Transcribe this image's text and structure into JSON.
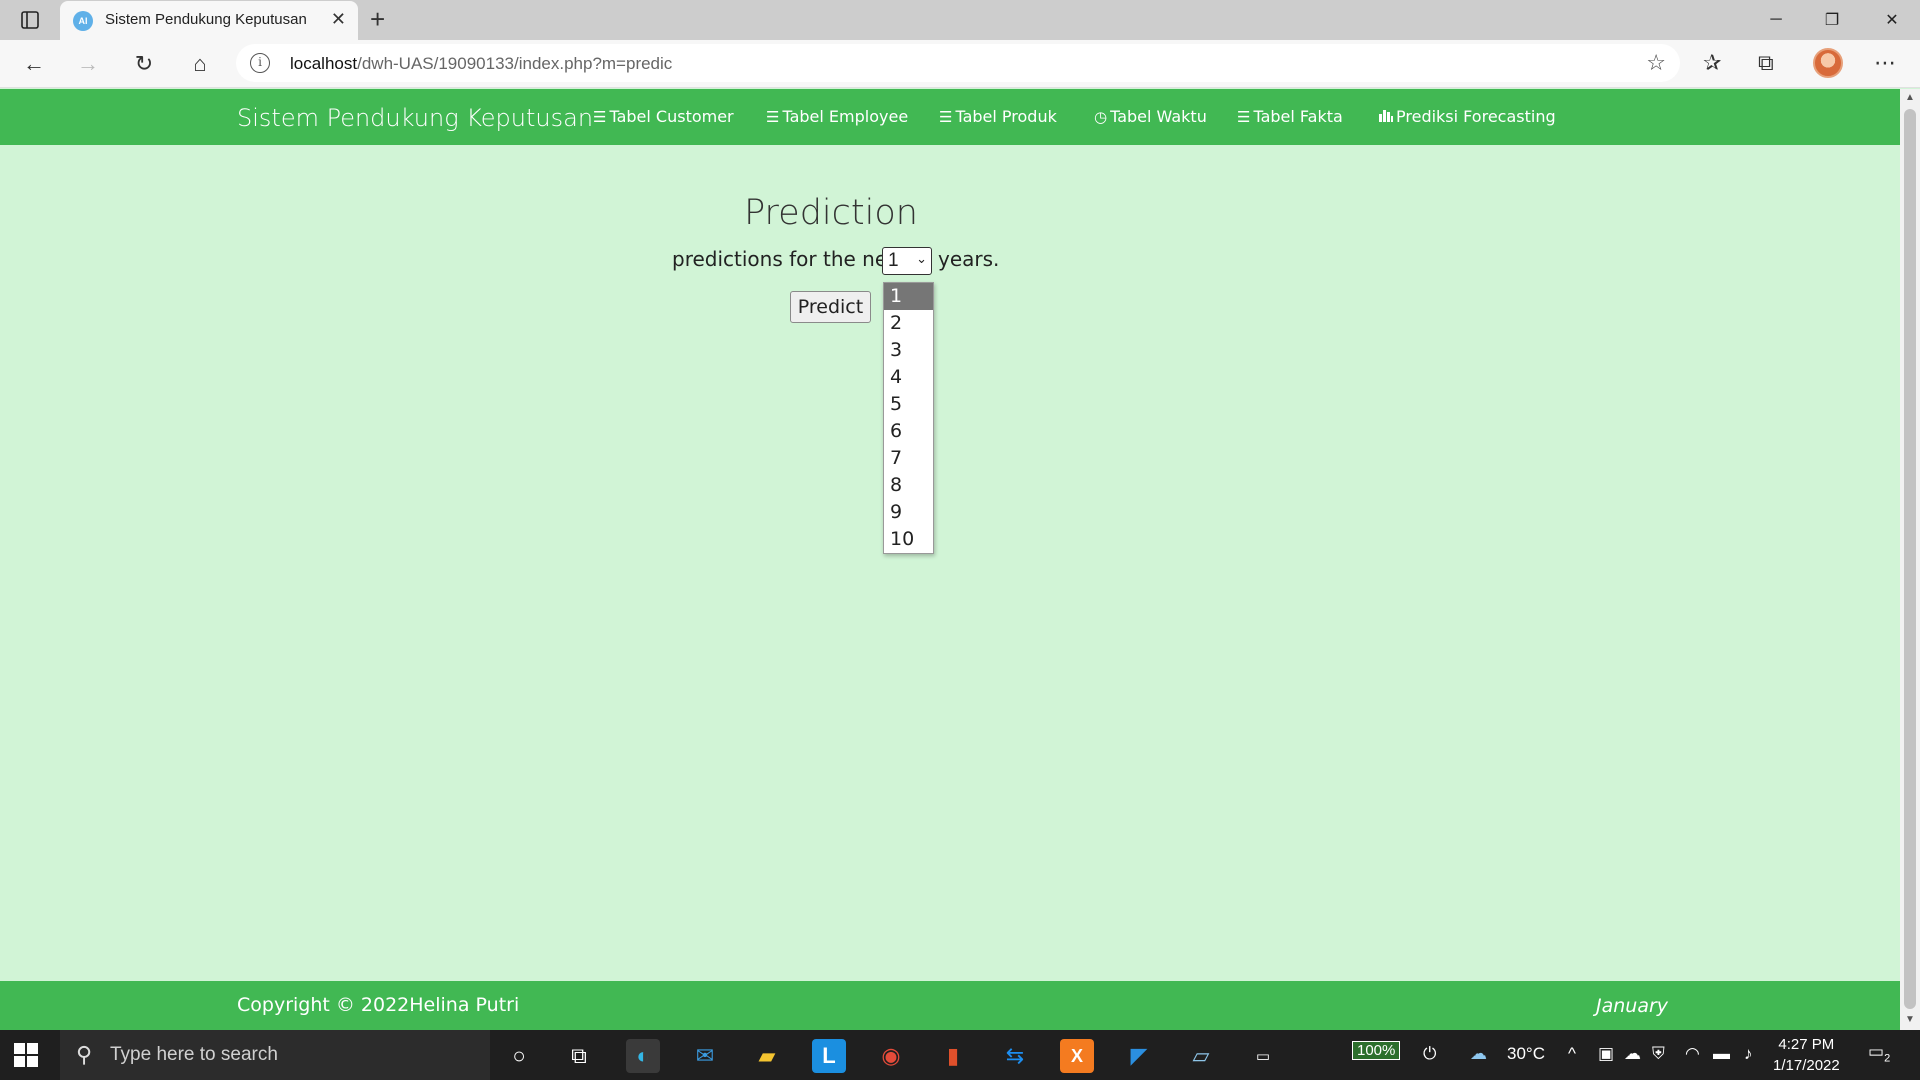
{
  "browser": {
    "tab_title": "Sistem Pendukung Keputusan",
    "url_host": "localhost",
    "url_path": "/dwh-UAS/19090133/index.php?m=predic"
  },
  "navbar": {
    "brand": "Sistem Pendukung Keputusan",
    "links": [
      {
        "label": "Tabel Customer",
        "icon": "list-icon"
      },
      {
        "label": "Tabel Employee",
        "icon": "list-icon"
      },
      {
        "label": "Tabel Produk",
        "icon": "list-icon"
      },
      {
        "label": "Tabel Waktu",
        "icon": "clock-icon"
      },
      {
        "label": "Tabel Fakta",
        "icon": "list-icon"
      },
      {
        "label": "Prediksi Forecasting",
        "icon": "bar-chart-icon"
      }
    ]
  },
  "main": {
    "heading": "Prediction",
    "prefix_text": "predictions for the next",
    "selected_years": "1",
    "suffix_text": "years.",
    "predict_button": "Predict",
    "year_options": [
      "1",
      "2",
      "3",
      "4",
      "5",
      "6",
      "7",
      "8",
      "9",
      "10"
    ]
  },
  "footer": {
    "copyright": "Copyright © 2022Helina Putri",
    "month": "January"
  },
  "taskbar": {
    "search_placeholder": "Type here to search",
    "battery": "100%",
    "temperature": "30°C",
    "time": "4:27 PM",
    "date": "1/17/2022",
    "notification_count": "2"
  },
  "colors": {
    "navbar_green": "#41b853",
    "page_background": "#d1f4d6"
  }
}
